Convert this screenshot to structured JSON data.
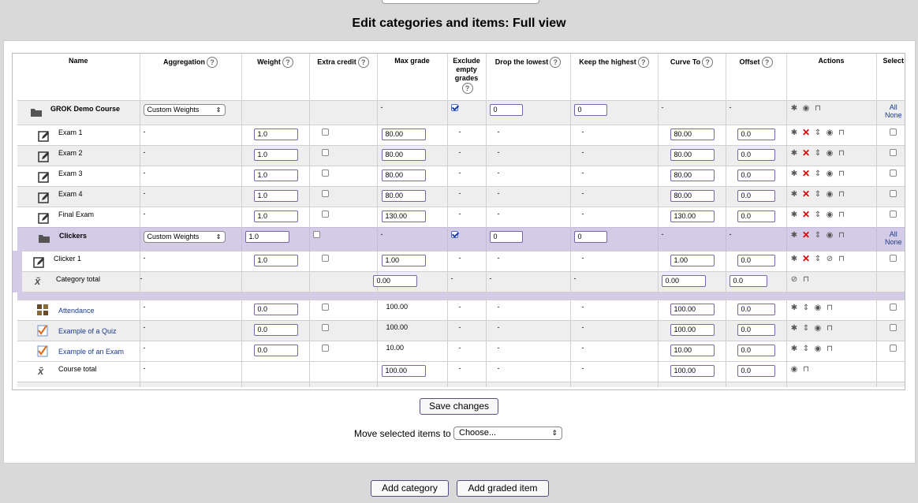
{
  "page": {
    "title": "Edit categories and items: Full view"
  },
  "columns": {
    "name": "Name",
    "aggregation": "Aggregation",
    "weight": "Weight",
    "extra_credit": "Extra credit",
    "max_grade": "Max grade",
    "exclude_empty": "Exclude empty grades",
    "drop_lowest": "Drop the lowest",
    "keep_highest": "Keep the highest",
    "curve_to": "Curve To",
    "offset": "Offset",
    "actions": "Actions",
    "select": "Select"
  },
  "help_glyph": "?",
  "rows": {
    "course": {
      "name": "GROK Demo Course",
      "aggregation": "Custom Weights",
      "max_grade": "-",
      "drop_lowest": "0",
      "keep_highest": "0",
      "curve_to": "-",
      "offset": "-",
      "select_all": "All",
      "select_none": "None"
    },
    "exam1": {
      "name": "Exam 1",
      "aggregation": "-",
      "weight": "1.0",
      "max_grade": "80.00",
      "exclude": "-",
      "drop": "-",
      "keep": "-",
      "curve_to": "80.00",
      "offset": "0.0"
    },
    "exam2": {
      "name": "Exam 2",
      "aggregation": "-",
      "weight": "1.0",
      "max_grade": "80.00",
      "exclude": "-",
      "drop": "-",
      "keep": "-",
      "curve_to": "80.00",
      "offset": "0.0"
    },
    "exam3": {
      "name": "Exam 3",
      "aggregation": "-",
      "weight": "1.0",
      "max_grade": "80.00",
      "exclude": "-",
      "drop": "-",
      "keep": "-",
      "curve_to": "80.00",
      "offset": "0.0"
    },
    "exam4": {
      "name": "Exam 4",
      "aggregation": "-",
      "weight": "1.0",
      "max_grade": "80.00",
      "exclude": "-",
      "drop": "-",
      "keep": "-",
      "curve_to": "80.00",
      "offset": "0.0"
    },
    "final": {
      "name": "Final Exam",
      "aggregation": "-",
      "weight": "1.0",
      "max_grade": "130.00",
      "exclude": "-",
      "drop": "-",
      "keep": "-",
      "curve_to": "130.00",
      "offset": "0.0"
    },
    "clickers": {
      "name": "Clickers",
      "aggregation": "Custom Weights",
      "weight": "1.0",
      "max_grade": "-",
      "drop_lowest": "0",
      "keep_highest": "0",
      "curve_to": "-",
      "offset": "-",
      "select_all": "All",
      "select_none": "None"
    },
    "clicker1": {
      "name": "Clicker 1",
      "aggregation": "-",
      "weight": "1.0",
      "max_grade": "1.00",
      "exclude": "-",
      "drop": "-",
      "keep": "-",
      "curve_to": "1.00",
      "offset": "0.0"
    },
    "cat_total": {
      "name": "Category total",
      "aggregation": "-",
      "max_grade": "0.00",
      "exclude": "-",
      "drop": "-",
      "keep": "-",
      "curve_to": "0.00",
      "offset": "0.0"
    },
    "attendance": {
      "name": "Attendance",
      "aggregation": "-",
      "weight": "0.0",
      "max_grade": "100.00",
      "exclude": "-",
      "drop": "-",
      "keep": "-",
      "curve_to": "100.00",
      "offset": "0.0"
    },
    "quiz": {
      "name": "Example of a Quiz",
      "aggregation": "-",
      "weight": "0.0",
      "max_grade": "100.00",
      "exclude": "-",
      "drop": "-",
      "keep": "-",
      "curve_to": "100.00",
      "offset": "0.0"
    },
    "exam_ex": {
      "name": "Example of an Exam",
      "aggregation": "-",
      "weight": "0.0",
      "max_grade": "10.00",
      "exclude": "-",
      "drop": "-",
      "keep": "-",
      "curve_to": "10.00",
      "offset": "0.0"
    },
    "course_total": {
      "name": "Course total",
      "aggregation": "-",
      "max_grade": "100.00",
      "exclude": "-",
      "drop": "-",
      "keep": "-",
      "curve_to": "100.00",
      "offset": "0.0"
    }
  },
  "buttons": {
    "save": "Save changes",
    "move_label": "Move selected items to",
    "move_select": "Choose...",
    "add_category": "Add category",
    "add_item": "Add graded item"
  },
  "icons": {
    "edit": "gear-icon",
    "delete": "delete-icon",
    "move": "move-icon",
    "show": "eye-icon",
    "hide": "eye-hidden-icon",
    "lock": "lock-icon",
    "folder": "folder-icon",
    "assignment": "assignment-icon",
    "total": "sigma-icon",
    "attendance": "attendance-icon",
    "quiz": "quiz-icon"
  },
  "colors": {
    "category_row": "#d4cce6",
    "alt_row": "#eeeeee",
    "link": "#1a3a8c",
    "delete": "#dd0000",
    "input_border": "#7a63b0"
  }
}
